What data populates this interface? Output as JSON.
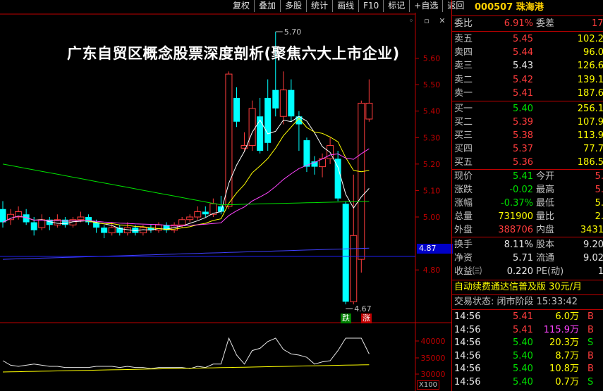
{
  "toolbar": {
    "buttons": [
      "复权",
      "叠加",
      "多股",
      "统计",
      "画线",
      "F10",
      "标记",
      "+自选",
      "返回"
    ]
  },
  "overlay_title": "广东自贸区概念股票深度剖析(聚焦六大上市企业)",
  "chart": {
    "price_ticks": [
      "5.60",
      "5.50",
      "5.40",
      "5.30",
      "5.20",
      "5.10",
      "5.00",
      "4.80"
    ],
    "last_price_label": "4.87",
    "high_marker": "5.70",
    "low_marker": "4.67",
    "badge_die": "跌",
    "badge_zhang": "涨",
    "vol_ticks": [
      "40000",
      "35000",
      "30000"
    ],
    "vol_scale": "X100"
  },
  "chart_data": {
    "type": "candlestick",
    "candles": [
      [
        5.03,
        4.98,
        5.06,
        4.96
      ],
      [
        4.99,
        5.01,
        5.03,
        4.97
      ],
      [
        5.0,
        5.02,
        5.04,
        4.99
      ],
      [
        5.01,
        4.98,
        5.03,
        4.97
      ],
      [
        4.98,
        4.95,
        5.0,
        4.93
      ],
      [
        4.96,
        4.99,
        5.01,
        4.95
      ],
      [
        4.99,
        4.97,
        5.0,
        4.95
      ],
      [
        4.97,
        4.99,
        5.01,
        4.96
      ],
      [
        4.99,
        4.97,
        5.0,
        4.96
      ],
      [
        4.97,
        4.99,
        5.0,
        4.96
      ],
      [
        4.99,
        5.0,
        5.02,
        4.98
      ],
      [
        5.0,
        4.98,
        5.01,
        4.97
      ],
      [
        4.98,
        4.96,
        4.99,
        4.94
      ],
      [
        4.96,
        4.94,
        4.97,
        4.92
      ],
      [
        4.94,
        4.96,
        4.98,
        4.93
      ],
      [
        4.96,
        4.94,
        4.97,
        4.93
      ],
      [
        4.94,
        4.96,
        4.98,
        4.93
      ],
      [
        4.96,
        4.94,
        4.97,
        4.93
      ],
      [
        4.94,
        4.96,
        4.97,
        4.93
      ],
      [
        4.96,
        4.95,
        4.97,
        4.94
      ],
      [
        4.95,
        4.97,
        4.98,
        4.94
      ],
      [
        4.97,
        4.95,
        4.98,
        4.94
      ],
      [
        4.95,
        4.97,
        4.98,
        4.94
      ],
      [
        4.97,
        4.99,
        5.0,
        4.96
      ],
      [
        4.99,
        5.0,
        5.01,
        4.98
      ],
      [
        5.0,
        5.02,
        5.04,
        4.99
      ],
      [
        5.02,
        5.01,
        5.04,
        5.0
      ],
      [
        5.01,
        5.05,
        5.07,
        5.0
      ],
      [
        5.04,
        5.02,
        5.08,
        5.01
      ],
      [
        5.04,
        5.54,
        5.55,
        5.03
      ],
      [
        5.45,
        5.36,
        5.49,
        5.34
      ],
      [
        5.26,
        5.27,
        5.32,
        5.25
      ],
      [
        5.27,
        5.41,
        5.44,
        5.25
      ],
      [
        5.38,
        5.25,
        5.45,
        5.24
      ],
      [
        5.45,
        5.28,
        5.52,
        5.25
      ],
      [
        5.48,
        5.41,
        5.7,
        5.38
      ],
      [
        5.38,
        5.48,
        5.55,
        5.35
      ],
      [
        5.48,
        5.38,
        5.52,
        5.36
      ],
      [
        5.38,
        5.35,
        5.4,
        5.25
      ],
      [
        5.29,
        5.19,
        5.3,
        5.17
      ],
      [
        5.21,
        5.19,
        5.23,
        5.16
      ],
      [
        5.19,
        5.22,
        5.24,
        5.15
      ],
      [
        5.22,
        5.27,
        5.3,
        5.2
      ],
      [
        5.22,
        5.07,
        5.25,
        5.06
      ],
      [
        5.05,
        4.68,
        5.06,
        4.67
      ],
      [
        4.68,
        4.93,
        5.16,
        4.67
      ],
      [
        4.84,
        5.43,
        5.44,
        4.79
      ],
      [
        5.37,
        5.43,
        5.52,
        5.36
      ]
    ],
    "ma_series": [
      {
        "color": "#ffffff"
      },
      {
        "color": "#ffff00"
      },
      {
        "color": "#ff44ff"
      },
      {
        "color": "#00e000"
      },
      {
        "color": "#4040ff"
      }
    ]
  },
  "quote": {
    "code": "000507",
    "name": "珠海港",
    "weibi_label": "委比",
    "weibi": "6.91%",
    "weicha_label": "委差",
    "weicha": "17",
    "asks": [
      {
        "label": "卖五",
        "price": "5.45",
        "vol": "102.2"
      },
      {
        "label": "卖四",
        "price": "5.44",
        "vol": "96.0"
      },
      {
        "label": "卖三",
        "price": "5.43",
        "vol": "126.6"
      },
      {
        "label": "卖二",
        "price": "5.42",
        "vol": "139.1"
      },
      {
        "label": "卖一",
        "price": "5.41",
        "vol": "187.6"
      }
    ],
    "bids": [
      {
        "label": "买一",
        "price": "5.40",
        "vol": "256.1"
      },
      {
        "label": "买二",
        "price": "5.39",
        "vol": "107.9"
      },
      {
        "label": "买三",
        "price": "5.38",
        "vol": "113.9"
      },
      {
        "label": "买四",
        "price": "5.37",
        "vol": "77.7"
      },
      {
        "label": "买五",
        "price": "5.36",
        "vol": "186.5"
      }
    ],
    "stats": [
      {
        "l1": "现价",
        "v1": "5.41",
        "l2": "今开",
        "v2": "5."
      },
      {
        "l1": "涨跌",
        "v1": "-0.02",
        "l2": "最高",
        "v2": "5."
      },
      {
        "l1": "涨幅",
        "v1": "-0.37%",
        "l2": "最低",
        "v2": "5."
      },
      {
        "l1": "总量",
        "v1": "731900",
        "l2": "量比",
        "v2": "2."
      },
      {
        "l1": "外盘",
        "v1": "388706",
        "l2": "内盘",
        "v2": "3431"
      }
    ],
    "stats2": [
      {
        "l1": "换手",
        "v1": "8.11%",
        "l2": "股本",
        "v2": "9.20"
      },
      {
        "l1": "净资",
        "v1": "5.71",
        "l2": "流通",
        "v2": "9.02"
      },
      {
        "l1": "收益㈢",
        "v1": "0.220",
        "l2": "PE(动)",
        "v2": "1"
      }
    ],
    "promo": "自动续费通达信普及版 30元/月",
    "status": "交易状态: 闭市阶段 15:33:42",
    "trades": [
      {
        "t": "14:56",
        "p": "5.41",
        "q": "6.0万",
        "s": "B"
      },
      {
        "t": "14:56",
        "p": "5.41",
        "q": "115.9万",
        "s": "B"
      },
      {
        "t": "14:56",
        "p": "5.40",
        "q": "20.3万",
        "s": "S"
      },
      {
        "t": "14:56",
        "p": "5.40",
        "q": "8.7万",
        "s": "B"
      },
      {
        "t": "14:56",
        "p": "5.40",
        "q": "10.8万",
        "s": "B"
      },
      {
        "t": "14:56",
        "p": "5.40",
        "q": "0.7万",
        "s": "S"
      }
    ]
  }
}
